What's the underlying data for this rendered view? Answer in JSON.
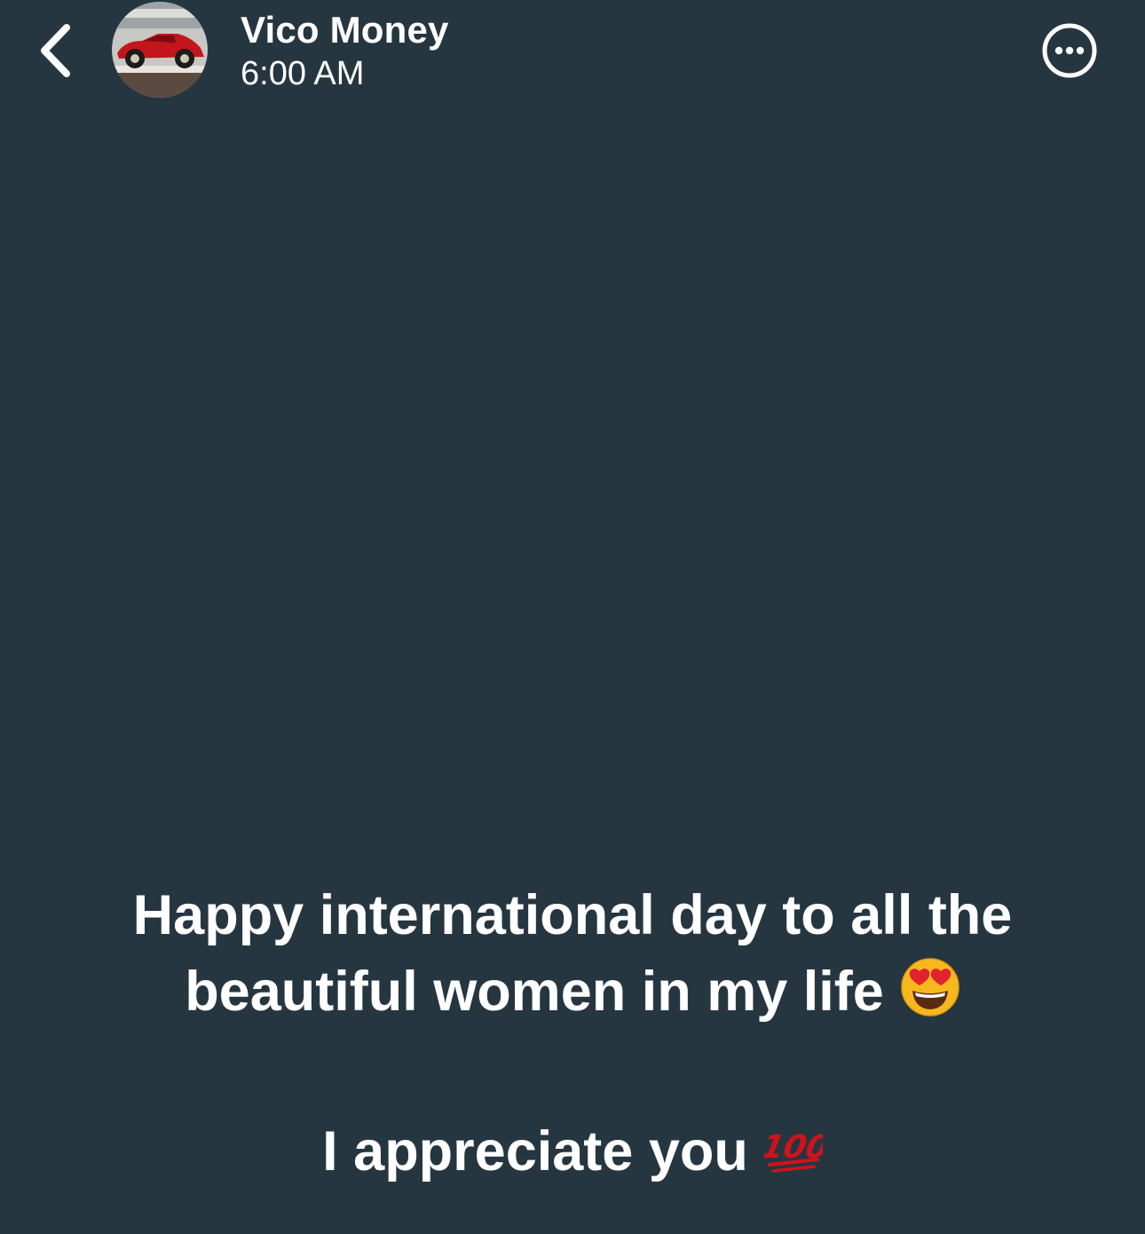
{
  "header": {
    "back_icon": "chevron-left-icon",
    "name": "Vico Money",
    "time": "6:00 AM",
    "avatar_icon": "red-vintage-car-photo",
    "more_icon": "more-options-circle-icon"
  },
  "status": {
    "line1": "Happy international day to all the",
    "line2": "beautiful women in my life",
    "line2_emoji": "smiling-face-with-heart-eyes-emoji",
    "line3": "I appreciate you",
    "line3_emoji": "hundred-points-emoji"
  },
  "colors": {
    "background": "#263641",
    "text": "#ffffff",
    "emoji_red": "#d0121c"
  }
}
